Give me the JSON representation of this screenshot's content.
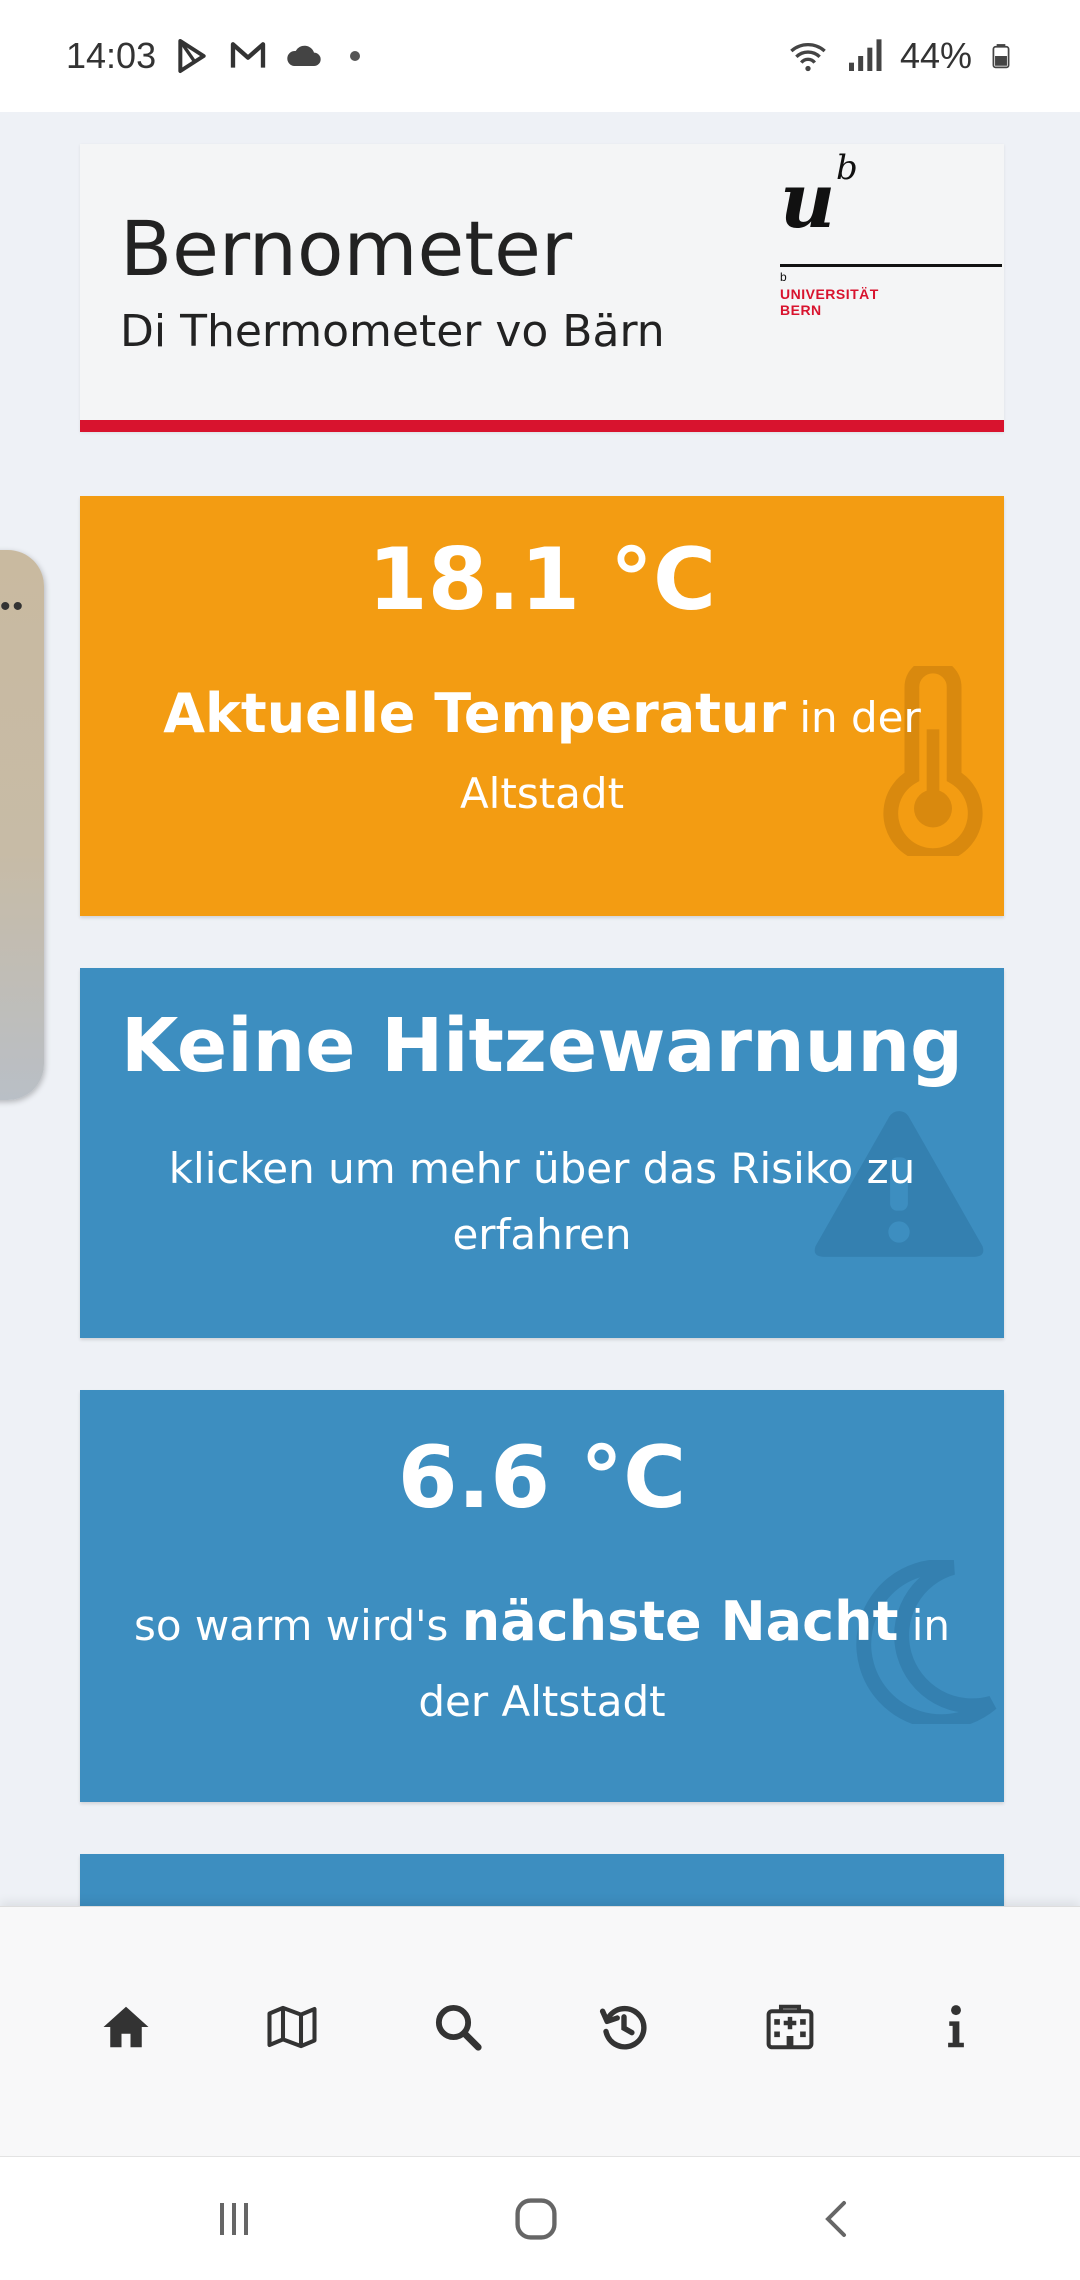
{
  "status_bar": {
    "time": "14:03",
    "battery": "44%",
    "icons_left": [
      "play-store-icon",
      "gmail-icon",
      "cloud-icon",
      "dot"
    ],
    "icons_right": [
      "wifi-icon",
      "signal-icon",
      "battery-icon"
    ]
  },
  "header": {
    "title": "Bernometer",
    "subtitle": "Di Thermometer vo Bärn",
    "logo": {
      "u": "u",
      "sup": "b",
      "small_b": "b",
      "line1": "UNIVERSITÄT",
      "line2": "BERN"
    }
  },
  "cards": {
    "current": {
      "value": "18.1 °C",
      "label_strong": "Aktuelle Temperatur",
      "label_rest": " in der",
      "label_line2": "Altstadt",
      "icon": "thermometer-icon",
      "color": "#f39c12"
    },
    "warning": {
      "title": "Keine Hitzewarnung",
      "text_line1": "klicken um mehr über das Risiko zu",
      "text_line2": "erfahren",
      "icon": "warning-triangle-icon",
      "color": "#3d8ec0"
    },
    "night": {
      "value": "6.6 °C",
      "text_pre": "so warm wird's ",
      "text_strong": "nächste Nacht",
      "text_post": " in",
      "text_line2": "der Altstadt",
      "icon": "moon-icon",
      "color": "#3d8ec0"
    }
  },
  "bottom_nav": {
    "items": [
      "home-icon",
      "map-icon",
      "search-icon",
      "history-icon",
      "hospital-icon",
      "info-icon"
    ]
  },
  "system_nav": {
    "items": [
      "recent-apps-icon",
      "home-circle-icon",
      "back-icon"
    ]
  }
}
